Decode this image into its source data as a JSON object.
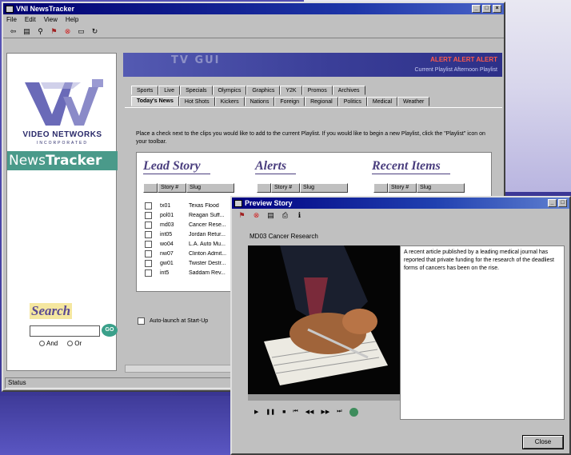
{
  "main_window": {
    "title": "VNI NewsTracker",
    "menu": [
      "File",
      "Edit",
      "View",
      "Help"
    ],
    "toolbar_icons": [
      "arrow-icon",
      "playlist-icon",
      "search-icon",
      "flag-icon",
      "stop-icon",
      "window-icon",
      "refresh-icon"
    ],
    "title_buttons": {
      "min": "_",
      "max": "□",
      "close": "×"
    },
    "banner": {
      "text": "TV GUI",
      "alert": "ALERT ALERT ALERT",
      "playlists": "Current Playlist  Afternoon Playlist"
    },
    "tabs_row1": [
      "Sports",
      "Live",
      "Specials",
      "Olympics",
      "Graphics",
      "Y2K",
      "Promos",
      "Archives"
    ],
    "tabs_row2": [
      "Today's News",
      "Hot Shots",
      "Kickers",
      "Nations",
      "Foreign",
      "Regional",
      "Politics",
      "Medical",
      "Weather"
    ],
    "instructions": "Place a check next to the clips you would like to add to the current Playlist. If you would like to begin a new Playlist, click the \"Playlist\" icon on your toolbar.",
    "sections": {
      "lead": "Lead Story",
      "alerts": "Alerts",
      "recent": "Recent Items"
    },
    "columns": {
      "story": "Story #",
      "slug": "Slug"
    },
    "lead_rows": [
      {
        "id": "tx01",
        "slug": "Texas Flood"
      },
      {
        "id": "pol01",
        "slug": "Reagan Suff..."
      },
      {
        "id": "md03",
        "slug": "Cancer Rese..."
      },
      {
        "id": "int05",
        "slug": "Jordan Retur..."
      },
      {
        "id": "wo04",
        "slug": "L.A. Auto Mu..."
      },
      {
        "id": "nw07",
        "slug": "Clinton Admit..."
      },
      {
        "id": "gw01",
        "slug": "Twister Destr..."
      },
      {
        "id": "int5",
        "slug": "Saddam Rev..."
      }
    ],
    "auto_launch": "Auto-launch at Start-Up",
    "status": "Status"
  },
  "left_panel": {
    "company": "VIDEO NETWORKS",
    "company_sub": "INCORPORATED",
    "product_prefix": "News",
    "product_suffix": "Tracker",
    "search_title": "Search",
    "search_value": "",
    "go_label": "GO",
    "radio_and": "And",
    "radio_or": "Or"
  },
  "preview": {
    "title": "Preview Story",
    "story_label": "MD03 Cancer Research",
    "story_text": "A recent article published by a leading medical journal has reported that private funding for the research of the deadliest forms of cancers has been on the rise.",
    "transport": [
      "▶",
      "❚❚",
      "■",
      "⏮",
      "◀◀",
      "▶▶",
      "⏭"
    ],
    "close_label": "Close"
  },
  "colors": {
    "title_bar": "#1e36a8",
    "accent_teal": "#4a9a8a",
    "alert_red": "#ff5a4a",
    "heading_purple": "#4a3e7e"
  }
}
